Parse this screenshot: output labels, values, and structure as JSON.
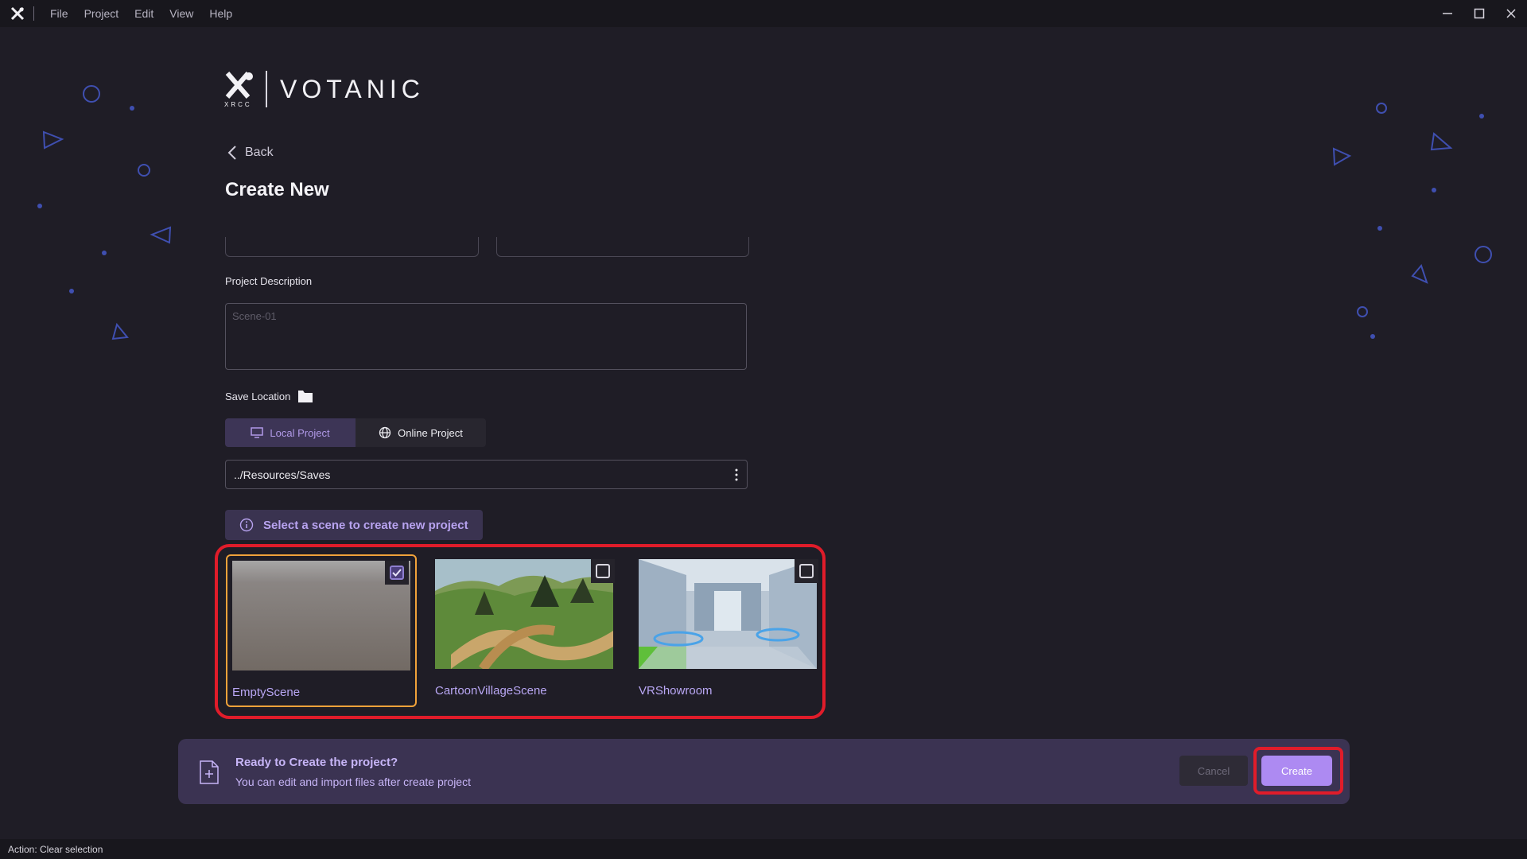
{
  "titlebar": {
    "menu": [
      {
        "label": "File"
      },
      {
        "label": "Project"
      },
      {
        "label": "Edit"
      },
      {
        "label": "View"
      },
      {
        "label": "Help"
      }
    ],
    "icons": [
      "app-logo-icon",
      "minimize-icon",
      "maximize-icon",
      "close-icon"
    ]
  },
  "brand": {
    "name": "VOTANIC",
    "mark_text": "XRCC"
  },
  "nav": {
    "back_label": "Back"
  },
  "page": {
    "title": "Create New"
  },
  "form": {
    "description_label": "Project Description",
    "description_placeholder": "Scene-01",
    "save_location_label": "Save Location",
    "local_project_label": "Local Project",
    "online_project_label": "Online Project",
    "selected_project_type": "Local Project",
    "path_value": "../Resources/Saves",
    "hint": "Select a scene to create new project"
  },
  "scenes": [
    {
      "name": "EmptyScene",
      "selected": true
    },
    {
      "name": "CartoonVillageScene",
      "selected": false
    },
    {
      "name": "VRShowroom",
      "selected": false
    }
  ],
  "footer": {
    "title": "Ready to Create the project?",
    "subtitle": "You can edit and import files after create project",
    "cancel_label": "Cancel",
    "create_label": "Create"
  },
  "status": {
    "text": "Action: Clear selection"
  },
  "colors": {
    "accent": "#ad8af2",
    "highlight_ring": "#e01c2a",
    "selected_border": "#f0a23a",
    "background": "#1f1d26"
  }
}
